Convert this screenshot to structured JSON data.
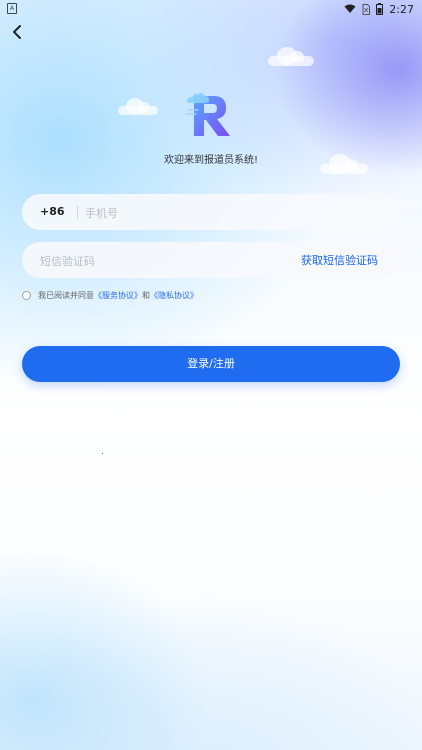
{
  "status_bar": {
    "left_icon": "A",
    "time": "2:27",
    "icons": [
      "wifi-icon",
      "sim-icon",
      "battery-icon"
    ]
  },
  "nav": {
    "back_icon": "chevron-left-icon"
  },
  "logo": {
    "letter": "R"
  },
  "welcome_text": "欢迎来到报道员系统!",
  "phone_field": {
    "country_code": "+86",
    "placeholder": "手机号"
  },
  "code_field": {
    "placeholder": "短信验证码",
    "get_code_label": "获取短信验证码"
  },
  "agreement": {
    "prefix": "我已阅读并同意",
    "service_link": "《服务协议》",
    "and": "和",
    "privacy_link": "《隐私协议》"
  },
  "login_button_label": "登录/注册",
  "colors": {
    "primary": "#1f6cf0",
    "link": "#2a6cf0",
    "logo_gradient_start": "#5aa8ff",
    "logo_gradient_end": "#7a4cf5"
  }
}
